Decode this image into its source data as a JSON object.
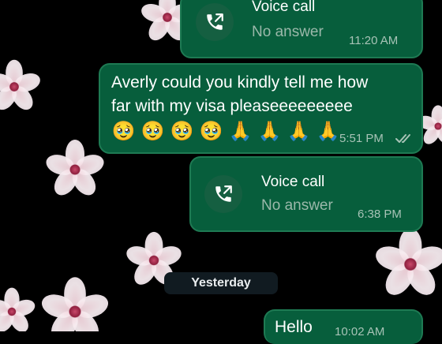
{
  "messages": [
    {
      "type": "voice_call",
      "title": "Voice call",
      "status": "No answer",
      "time": "11:20 AM"
    },
    {
      "type": "text",
      "line1": "Averly could you kindly tell me how",
      "line2": "far with my visa pleaseeeeeeeee",
      "emojis": [
        "🥹",
        "🥹",
        "🥹",
        "🥹",
        "🙏",
        "🙏",
        "🙏",
        "🙏"
      ],
      "time": "5:51 PM"
    },
    {
      "type": "voice_call",
      "title": "Voice call",
      "status": "No answer",
      "time": "6:38 PM"
    }
  ],
  "date_separator": "Yesterday",
  "partial_message": {
    "text": "Hello",
    "time": "10:02 AM"
  },
  "icons": {
    "call": "outgoing-call-icon",
    "read_receipt": "double-check-icon"
  },
  "colors": {
    "outgoing_bubble": "#075e3c",
    "bubble_border": "#1e7a53",
    "background": "#000000"
  }
}
